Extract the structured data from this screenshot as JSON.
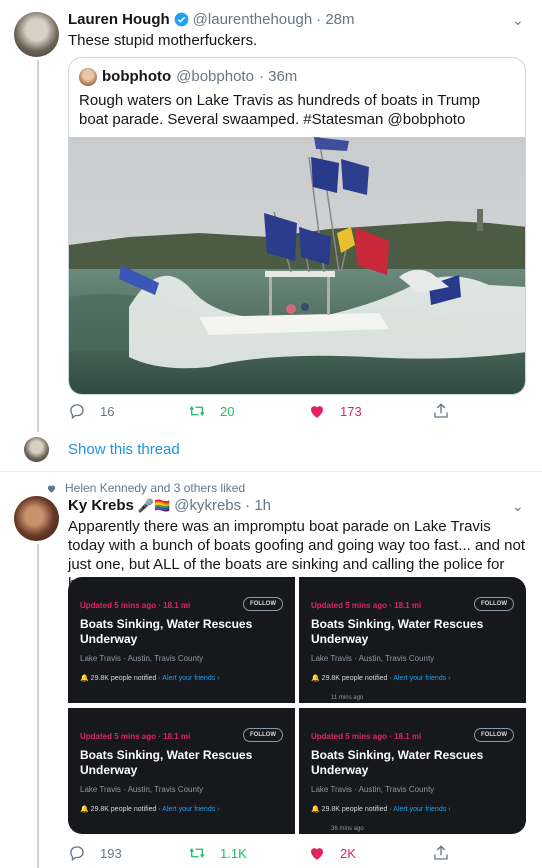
{
  "tweet1": {
    "name": "Lauren Hough",
    "handle": "@laurenthehough",
    "time": "· 28m",
    "text": "These stupid motherfuckers.",
    "quote": {
      "name": "bobphoto",
      "handle": "@bobphoto",
      "time": "· 36m",
      "text": "Rough waters on Lake Travis as hundreds of boats in Trump boat parade.   Several swaamped.  #Statesman @bobphoto"
    },
    "replies": "16",
    "retweets": "20",
    "likes": "173"
  },
  "show_thread": "Show this thread",
  "tweet2": {
    "liked_by": "Helen Kennedy and 3 others liked",
    "name": "Ky Krebs",
    "name_emoji": "🎤🏳️‍🌈",
    "handle": "@kykrebs",
    "time": "· 1h",
    "text": "Apparently there was an impromptu boat parade on Lake Travis today with a bunch of boats goofing and going way too fast... and not just one, but ALL of the boats are sinking and calling the police for help.",
    "cards": [
      {
        "updated": "Updated 5 mins ago · 18.1 mi",
        "follow": "FOLLOW",
        "title": "Boats Sinking, Water Rescues Underway",
        "location": "Lake Travis · Austin, Travis County",
        "notified": "29.8K people notified · ",
        "alert": "Alert your friends ›",
        "ago": ""
      },
      {
        "updated": "Updated 5 mins ago · 18.1 mi",
        "follow": "FOLLOW",
        "title": "Boats Sinking, Water Rescues Underway",
        "location": "Lake Travis · Austin, Travis County",
        "notified": "29.8K people notified · ",
        "alert": "Alert your friends ›",
        "ago": "11 mins ago"
      },
      {
        "updated": "Updated 5 mins ago · 18.1 mi",
        "follow": "FOLLOW",
        "title": "Boats Sinking, Water Rescues Underway",
        "location": "Lake Travis · Austin, Travis County",
        "notified": "29.8K people notified · ",
        "alert": "Alert your friends ›",
        "ago": ""
      },
      {
        "updated": "Updated 5 mins ago · 18.1 mi",
        "follow": "FOLLOW",
        "title": "Boats Sinking, Water Rescues Underway",
        "location": "Lake Travis · Austin, Travis County",
        "notified": "29.8K people notified · ",
        "alert": "Alert your friends ›",
        "ago": "36 mins ago"
      }
    ],
    "replies": "193",
    "retweets": "1.1K",
    "likes": "2K"
  },
  "colors": {
    "retweet": "#17bf63",
    "like": "#e0245e",
    "link": "#1b95e0",
    "muted": "#657786"
  },
  "icons": [
    "verified-icon",
    "chevron-down-icon",
    "reply-icon",
    "retweet-icon",
    "heart-icon",
    "share-icon"
  ]
}
